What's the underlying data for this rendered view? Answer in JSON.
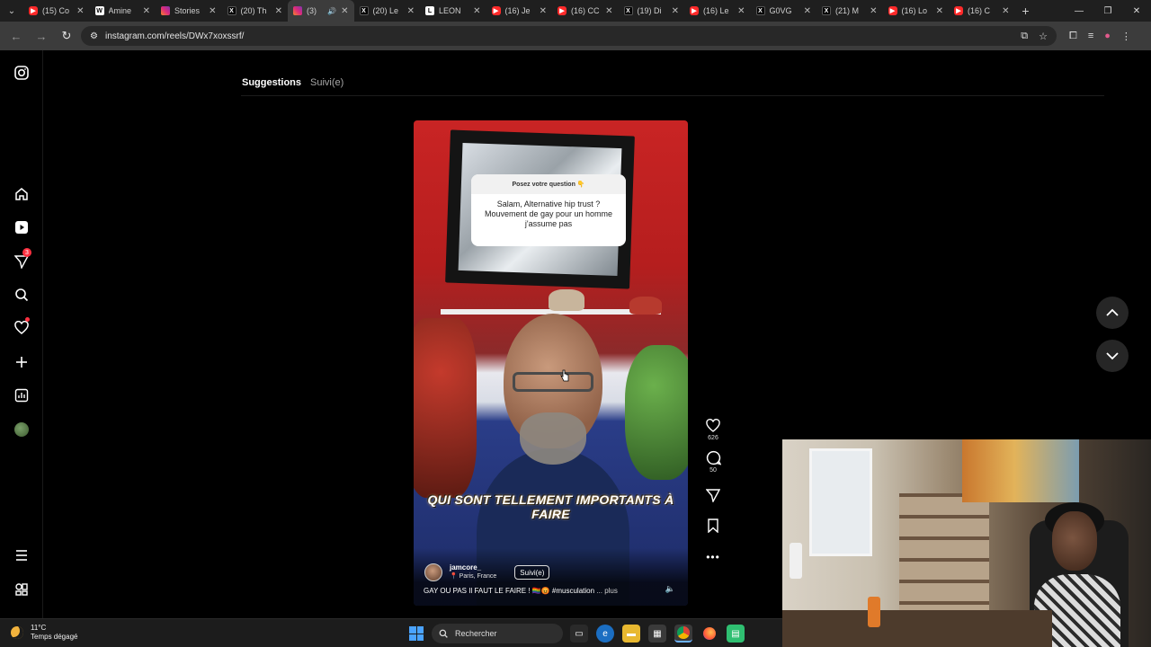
{
  "browser": {
    "tabs": [
      {
        "title": "(15) Co",
        "favicon": "yt"
      },
      {
        "title": "Amine",
        "favicon": "w"
      },
      {
        "title": "Stories",
        "favicon": "ig"
      },
      {
        "title": "(20) Th",
        "favicon": "x"
      },
      {
        "title": "(3)",
        "favicon": "ig",
        "active": true
      },
      {
        "title": "(20) Le",
        "favicon": "x"
      },
      {
        "title": "LEON",
        "favicon": "leon"
      },
      {
        "title": "(16) Je",
        "favicon": "yt"
      },
      {
        "title": "(16) CC",
        "favicon": "yt"
      },
      {
        "title": "(19) Di",
        "favicon": "x"
      },
      {
        "title": "(16) Le",
        "favicon": "yt"
      },
      {
        "title": "G0VG",
        "favicon": "x"
      },
      {
        "title": "(21) M",
        "favicon": "x"
      },
      {
        "title": "(16) Lo",
        "favicon": "yt"
      },
      {
        "title": "(16) C",
        "favicon": "yt"
      }
    ],
    "url": "instagram.com/reels/DWx7xoxssrf/"
  },
  "reels": {
    "tab_suggestions": "Suggestions",
    "tab_following": "Suivi(e)"
  },
  "sidebar": {
    "messages_badge": "3"
  },
  "video": {
    "question_header": "Posez votre question 👇",
    "question_text": "Salam, Alternative hip trust ? Mouvement de gay pour un homme j'assume pas",
    "caption": "QUI SONT TELLEMENT IMPORTANTS À FAIRE",
    "username": "jamcore_",
    "location": "Paris, France",
    "follow_label": "Suivi(e)",
    "description": "GAY OU PAS Il FAUT LE FAIRE ! 🏳️‍🌈😡 #musculation",
    "more_label": "... plus"
  },
  "actions": {
    "likes": "626",
    "comments": "50"
  },
  "taskbar": {
    "temperature": "11°C",
    "weather": "Temps dégagé",
    "search_label": "Rechercher"
  },
  "colors": {
    "accent_badge": "#ff3040",
    "chrome_bg": "#1f1f1f",
    "toolbar_bg": "#3c3c3c"
  }
}
